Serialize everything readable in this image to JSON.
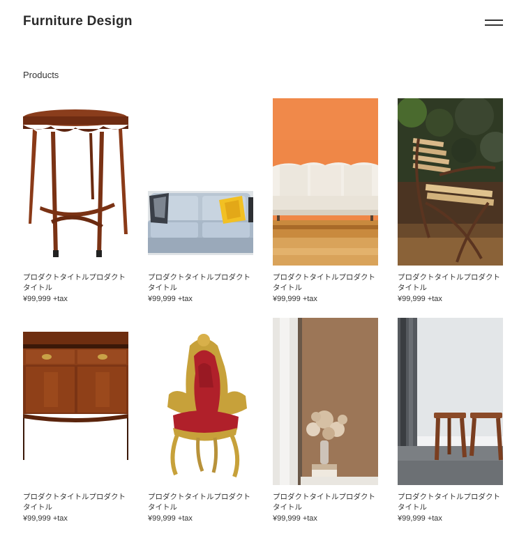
{
  "header": {
    "title": "Furniture Design",
    "menu_icon": "hamburger-icon"
  },
  "section": {
    "title": "Products"
  },
  "products": [
    {
      "name": "プロダクトタイトルプロダクトタイトル",
      "price": "¥99,999 +tax",
      "image": "wooden-side-table"
    },
    {
      "name": "プロダクトタイトルプロダクトタイトル",
      "price": "¥99,999 +tax",
      "image": "light-blue-sofa"
    },
    {
      "name": "プロダクトタイトルプロダクトタイトル",
      "price": "¥99,999 +tax",
      "image": "white-sofa-orange-wall"
    },
    {
      "name": "プロダクトタイトルプロダクトタイトル",
      "price": "¥99,999 +tax",
      "image": "wooden-garden-chair"
    },
    {
      "name": "プロダクトタイトルプロダクトタイトル",
      "price": "¥99,999 +tax",
      "image": "wooden-sideboard"
    },
    {
      "name": "プロダクトタイトルプロダクトタイトル",
      "price": "¥99,999 +tax",
      "image": "gilded-throne-chair"
    },
    {
      "name": "プロダクトタイトルプロダクトタイトル",
      "price": "¥99,999 +tax",
      "image": "dried-flowers-vase"
    },
    {
      "name": "プロダクトタイトルプロダクトタイトル",
      "price": "¥99,999 +tax",
      "image": "wooden-stools"
    }
  ]
}
